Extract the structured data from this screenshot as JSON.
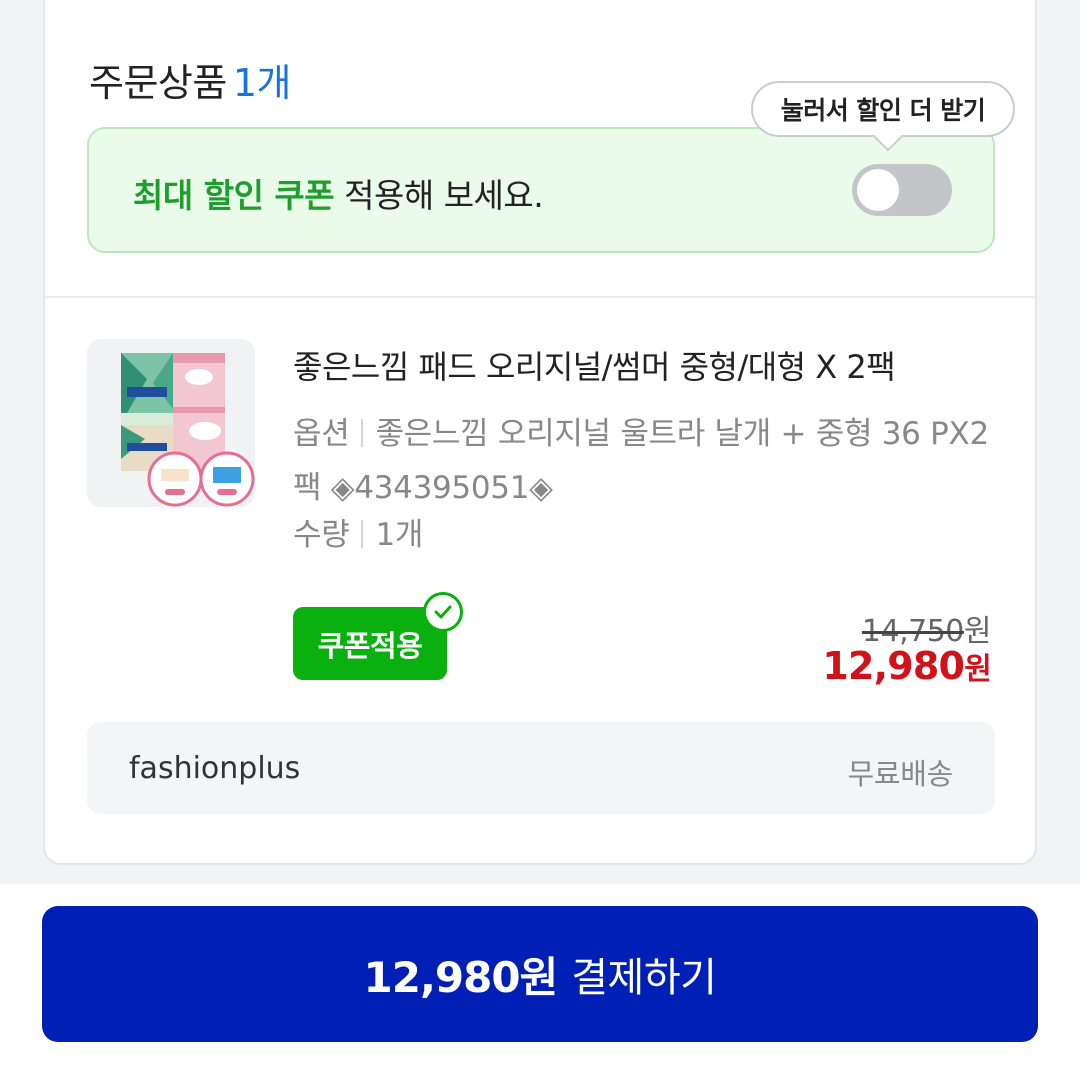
{
  "order_section": {
    "title": "주문상품",
    "count": "1개"
  },
  "coupon_banner": {
    "highlight": "최대 할인 쿠폰",
    "text": " 적용해 보세요.",
    "tooltip": "눌러서 할인 더 받기",
    "toggle_on": false
  },
  "product": {
    "name": "좋은느낌 패드 오리지널/썸머 중형/대형 X 2팩",
    "option_label": "옵션",
    "option_value": "좋은느낌 오리지널 울트라 날개 + 중형 36 PX2팩 ◈434395051◈",
    "quantity_label": "수량",
    "quantity_value": "1개",
    "coupon_button": "쿠폰적용",
    "original_price": "14,750",
    "sale_price": "12,980",
    "currency": "원"
  },
  "shipping": {
    "seller": "fashionplus",
    "fee": "무료배송"
  },
  "checkout": {
    "amount": "12,980원",
    "label": "결제하기"
  },
  "colors": {
    "accent_blue": "#0020b5",
    "count_blue": "#1a73d8",
    "coupon_green": "#0ab00f",
    "sale_red": "#d0131b"
  }
}
